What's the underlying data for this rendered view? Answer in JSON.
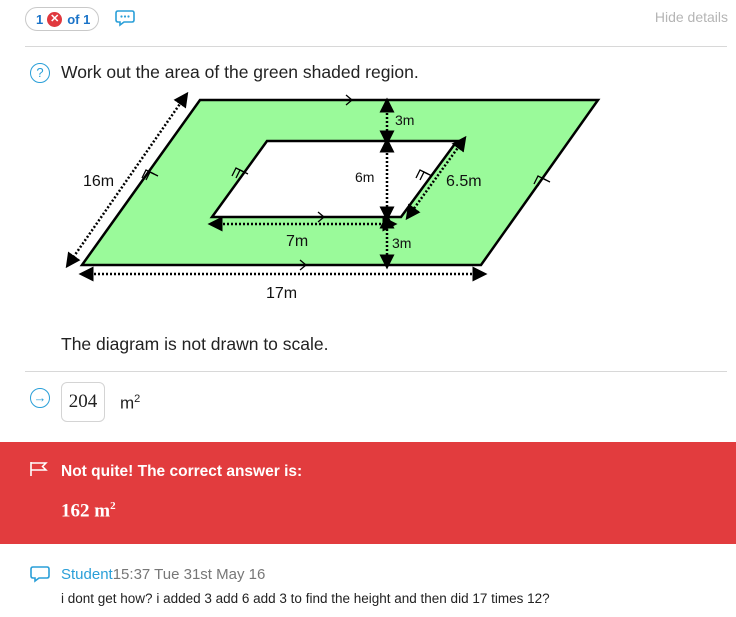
{
  "top": {
    "attempt_number": "1",
    "of_text": "of 1",
    "hide_details": "Hide details"
  },
  "question": {
    "text": "Work out the area of the green shaded region.",
    "note": "The diagram is not drawn to scale."
  },
  "diagram": {
    "labels": {
      "top_gap": "3m",
      "inner_height": "6m",
      "bottom_gap": "3m",
      "inner_base": "7m",
      "slant_inner": "6.5m",
      "slant_outer": "16m",
      "outer_base": "17m"
    },
    "colors": {
      "shaded": "#9afa9a",
      "stroke": "#000000"
    }
  },
  "answer": {
    "value": "204",
    "unit": "m",
    "unit_power": "2"
  },
  "feedback": {
    "title": "Not quite! The correct answer is:",
    "correct_value": "162",
    "unit": "m",
    "unit_power": "2",
    "color": "#e23c3e"
  },
  "comment": {
    "author": "Student",
    "time": "15:37 Tue 31st May 16",
    "text": "i dont get how? i added 3 add 6 add 3 to find the height and then did 17 times 12?"
  },
  "icons": {
    "status": "x-circle-icon",
    "chat": "chat-bubble-icon",
    "question": "question-circle-icon",
    "answer": "arrow-circle-icon",
    "flag": "flag-icon"
  }
}
